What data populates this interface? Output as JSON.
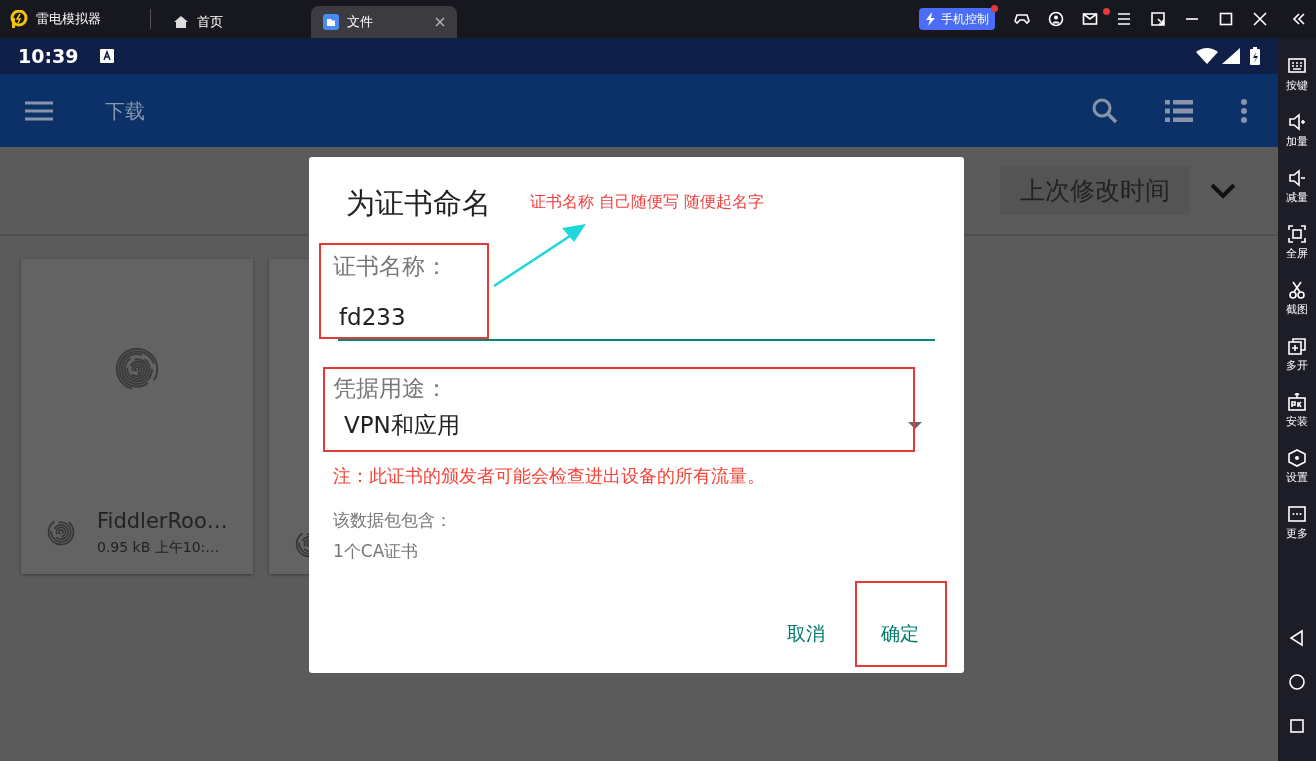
{
  "titlebar": {
    "app_name": "雷电模拟器",
    "tabs": [
      {
        "label": "首页",
        "selected": false
      },
      {
        "label": "文件",
        "selected": true
      }
    ],
    "phone_control": "手机控制"
  },
  "status_bar": {
    "time": "10:39"
  },
  "app_bar": {
    "title": "下载"
  },
  "sort": {
    "label": "上次修改时间"
  },
  "files": [
    {
      "name": "FiddlerRoo…",
      "meta": "0.95 kB 上午10:…"
    }
  ],
  "dialog": {
    "title": "为证书命名",
    "name_label": "证书名称：",
    "name_value": "fd233",
    "usage_label": "凭据用途：",
    "usage_value": "VPN和应用",
    "warning": "注：此证书的颁发者可能会检查进出设备的所有流量。",
    "info": [
      "该数据包包含：",
      "1个CA证书"
    ],
    "buttons": [
      "取消",
      "确定"
    ]
  },
  "annotation": {
    "note": "证书名称 自己随便写 随便起名字"
  },
  "sidebar": [
    {
      "label": "按键"
    },
    {
      "label": "加量"
    },
    {
      "label": "减量"
    },
    {
      "label": "全屏"
    },
    {
      "label": "截图"
    },
    {
      "label": "多开"
    },
    {
      "label": "安装"
    },
    {
      "label": "设置"
    },
    {
      "label": "更多"
    }
  ]
}
